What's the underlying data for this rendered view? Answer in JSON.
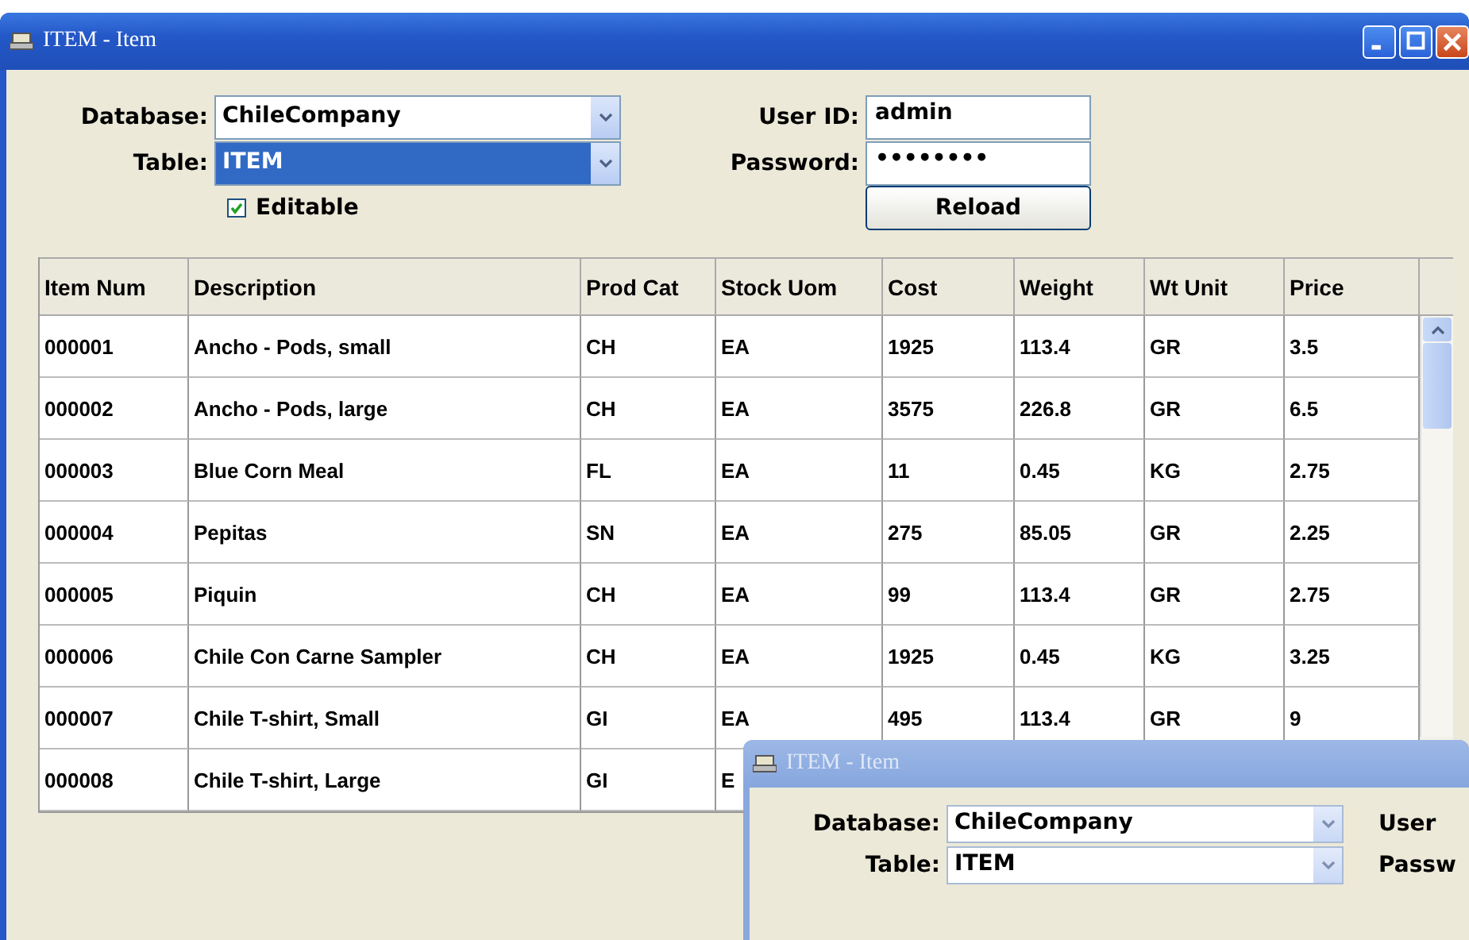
{
  "window": {
    "title": "ITEM - Item"
  },
  "form": {
    "database": {
      "label": "Database:",
      "value": "ChileCompany"
    },
    "table": {
      "label": "Table:",
      "value": "ITEM",
      "selected": true
    },
    "editable": {
      "label": "Editable",
      "checked": true
    },
    "user_id": {
      "label": "User ID:",
      "value": "admin"
    },
    "password": {
      "label": "Password:",
      "value": "••••••••"
    },
    "reload": {
      "label": "Reload"
    }
  },
  "table": {
    "columns": [
      "Item Num",
      "Description",
      "Prod Cat",
      "Stock Uom",
      "Cost",
      "Weight",
      "Wt Unit",
      "Price"
    ],
    "rows": [
      {
        "cells": [
          "000001",
          "Ancho - Pods, small",
          "CH",
          "EA",
          "1925",
          "113.4",
          "GR",
          "3.5"
        ]
      },
      {
        "cells": [
          "000002",
          "Ancho - Pods, large",
          "CH",
          "EA",
          "3575",
          "226.8",
          "GR",
          "6.5"
        ]
      },
      {
        "cells": [
          "000003",
          "Blue Corn Meal",
          "FL",
          "EA",
          "11",
          "0.45",
          "KG",
          "2.75"
        ]
      },
      {
        "cells": [
          "000004",
          "Pepitas",
          "SN",
          "EA",
          "275",
          "85.05",
          "GR",
          "2.25"
        ]
      },
      {
        "cells": [
          "000005",
          "Piquin",
          "CH",
          "EA",
          "99",
          "113.4",
          "GR",
          "2.75"
        ]
      },
      {
        "cells": [
          "000006",
          "Chile Con Carne Sampler",
          "CH",
          "EA",
          "1925",
          "0.45",
          "KG",
          "3.25"
        ]
      },
      {
        "cells": [
          "000007",
          "Chile T-shirt, Small",
          "GI",
          "EA",
          "495",
          "113.4",
          "GR",
          "9"
        ]
      },
      {
        "cells": [
          "000008",
          "Chile T-shirt, Large",
          "GI",
          "E"
        ]
      }
    ]
  },
  "second_window": {
    "title": "ITEM - Item",
    "database": {
      "label": "Database:",
      "value": "ChileCompany"
    },
    "table": {
      "label": "Table:",
      "value": "ITEM",
      "selected": false
    },
    "user_id_label": "User",
    "password_label": "Passw"
  }
}
